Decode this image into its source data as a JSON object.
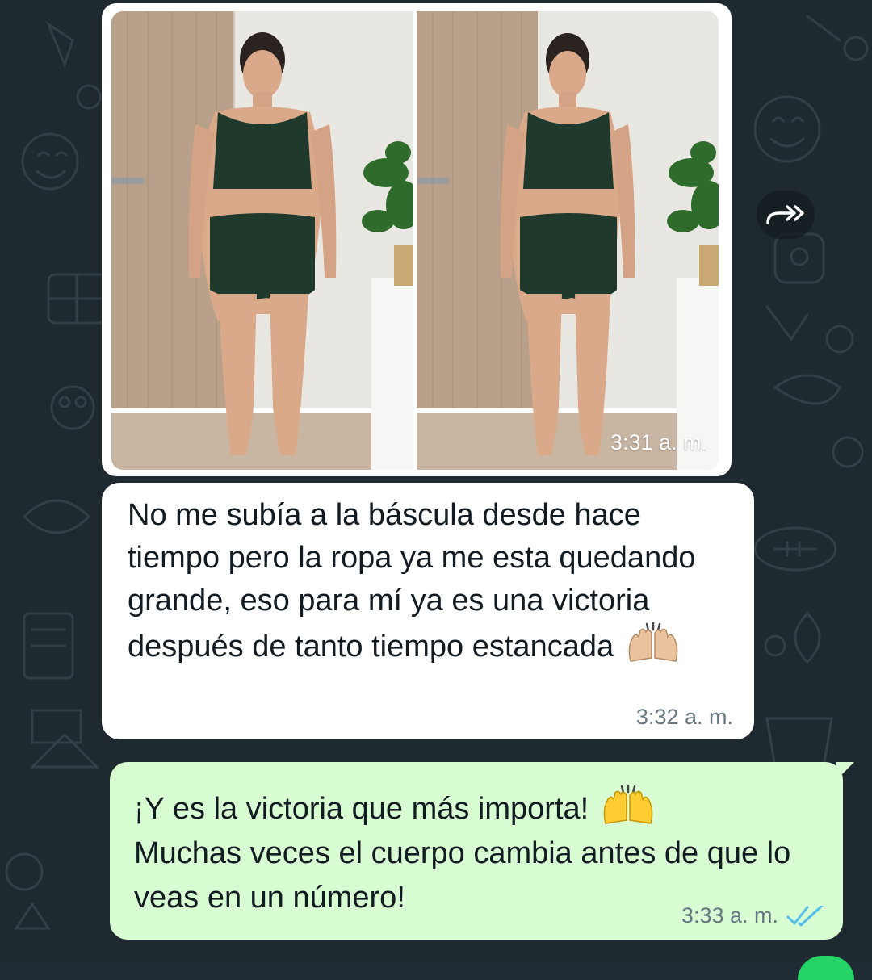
{
  "chat": {
    "photo_message": {
      "time": "3:31 a. m.",
      "images": [
        "before-photo",
        "after-photo"
      ]
    },
    "incoming_message": {
      "text": "No me subía a la báscula desde hace tiempo pero la ropa ya me esta quedando grande, eso para mí ya es una victoria después de tanto tiempo estancada",
      "emoji": "raising-hands-medium-light-skin",
      "time": "3:32 a. m."
    },
    "outgoing_message": {
      "text_line1": "¡Y es la victoria que más importa!",
      "emoji": "raising-hands",
      "text_rest": "Muchas veces el cuerpo cambia antes de que lo veas en un número!",
      "time": "3:33 a. m.",
      "status_icon": "double-check-read-icon"
    }
  },
  "colors": {
    "wallpaper": "#1f2a30",
    "incoming_bubble": "#ffffff",
    "outgoing_bubble": "#d9fdd3",
    "read_ticks": "#53bdeb"
  }
}
